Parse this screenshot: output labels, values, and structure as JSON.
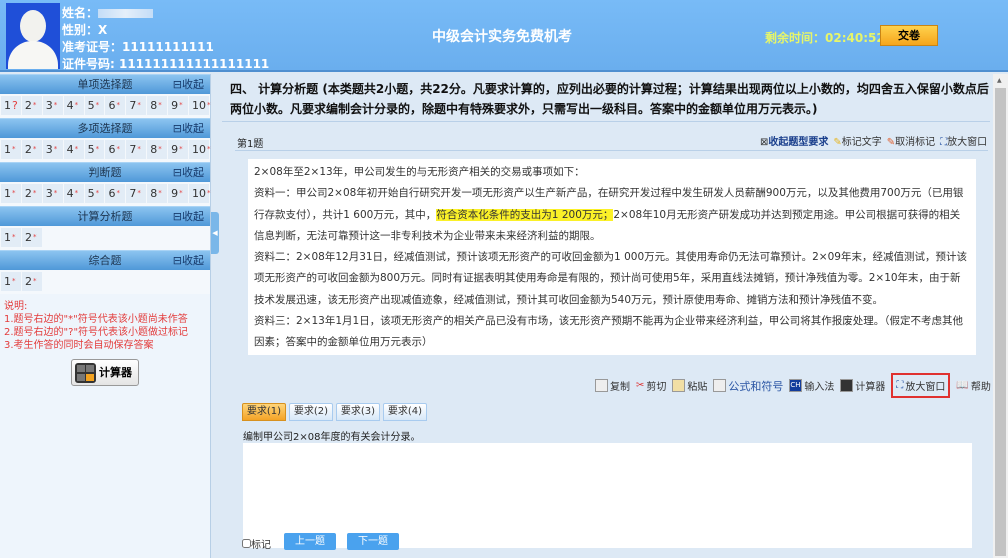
{
  "header": {
    "name_label": "姓名：",
    "gender": "性别：X",
    "exam_no": "准考证号：11111111111",
    "id_no": "证件号码: 111111111111111111",
    "title": "中级会计实务免费机考",
    "timer_label": "剩余时间：",
    "timer": "02:40:52",
    "submit": "交卷"
  },
  "sidebar": {
    "collapse": "⊟收起",
    "sections": [
      {
        "title": "单项选择题",
        "items": [
          "1",
          "2",
          "3",
          "4",
          "5",
          "6",
          "7",
          "8",
          "9",
          "10"
        ],
        "marked": [
          0
        ]
      },
      {
        "title": "多项选择题",
        "items": [
          "1",
          "2",
          "3",
          "4",
          "5",
          "6",
          "7",
          "8",
          "9",
          "10"
        ]
      },
      {
        "title": "判断题",
        "items": [
          "1",
          "2",
          "3",
          "4",
          "5",
          "6",
          "7",
          "8",
          "9",
          "10"
        ]
      },
      {
        "title": "计算分析题",
        "items": [
          "1",
          "2"
        ]
      },
      {
        "title": "综合题",
        "items": [
          "1",
          "2"
        ]
      }
    ],
    "notes": [
      "说明:",
      "1.题号右边的\"*\"符号代表该小题尚未作答",
      "2.题号右边的\"?\"符号代表该小题做过标记",
      "3.考生作答的同时会自动保存答案"
    ],
    "calculator": "计算器"
  },
  "main": {
    "heading": "四、 计算分析题 (本类题共2小题，共22分。凡要求计算的，应列出必要的计算过程；计算结果出现两位以上小数的，均四舍五入保留小数点后两位小数。凡要求编制会计分录的，除题中有特殊要求外，只需写出一级科目。答案中的金额单位用万元表示。)",
    "qno": "第1题",
    "qtools": [
      "收起题型要求",
      "标记文字",
      "取消标记",
      "放大窗口"
    ],
    "question": {
      "p0": "2×08年至2×13年，甲公司发生的与无形资产相关的交易或事项如下：",
      "p1a": "资料一：甲公司2×08年初开始自行研究开发一项无形资产以生产新产品，在研究开发过程中发生研发人员薪酬900万元，以及其他费用700万元（已用银行存款支付），共计1 600万元，其中，",
      "p1hl": "符合资本化条件的支出为1 200万元；",
      "p1b": "2×08年10月无形资产研发成功并达到预定用途。甲公司根据可获得的相关信息判断，无法可靠预计这一非专利技术为企业带来未来经济利益的期限。",
      "p2": "资料二：2×08年12月31日，经减值测试，预计该项无形资产的可收回金额为1 000万元。其使用寿命仍无法可靠预计。2×09年末，经减值测试，预计该项无形资产的可收回金额为800万元。同时有证据表明其使用寿命是有限的，预计尚可使用5年，采用直线法摊销，预计净残值为零。2×10年末，由于新技术发展迅速，该无形资产出现减值迹象，经减值测试，预计其可收回金额为540万元，预计原使用寿命、摊销方法和预计净残值不变。",
      "p3": "资料三：2×13年1月1日，该项无形资产的相关产品已没有市场，该无形资产预期不能再为企业带来经济利益，甲公司将其作报废处理。（假定不考虑其他因素；答案中的金额单位用万元表示）"
    },
    "toolbar": [
      "复制",
      "剪切",
      "粘贴",
      "公式和符号",
      "输入法",
      "计算器",
      "放大窗口",
      "帮助"
    ],
    "tabs": [
      "要求(1)",
      "要求(2)",
      "要求(3)",
      "要求(4)"
    ],
    "requirement": "编制甲公司2×08年度的有关会计分录。",
    "answer": "",
    "mark": "标记",
    "prev": "上一题",
    "next": "下一题"
  },
  "colors": {
    "header": "#6db5f5",
    "accent": "#f5a51c",
    "highlight_box": "#e0312f"
  }
}
